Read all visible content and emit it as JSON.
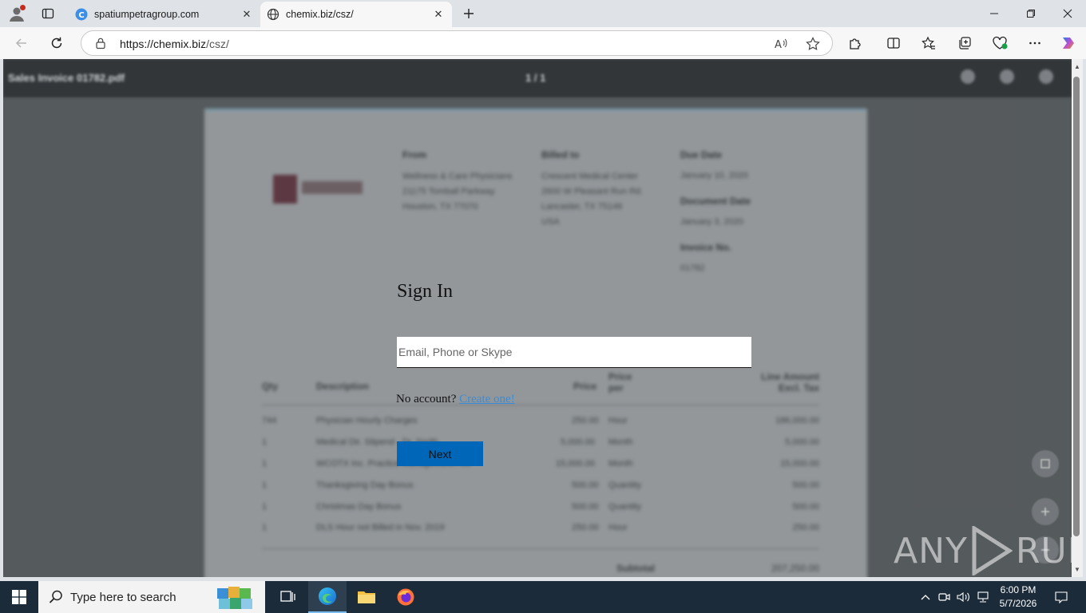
{
  "browser": {
    "tabs": [
      {
        "title": "spatiumpetragroup.com",
        "active": false
      },
      {
        "title": "chemix.biz/csz/",
        "active": true
      }
    ],
    "address": {
      "host": "https://chemix.biz",
      "path": "/csz/"
    }
  },
  "pdf_viewer": {
    "file_name": "Sales Invoice 01782.pdf",
    "page_indicator": "1 / 1"
  },
  "invoice_background": {
    "from_label": "From",
    "from_lines": [
      "Wellness & Care Physicians",
      "21175 Tomball Parkway",
      "Houston, TX 77070"
    ],
    "billed_label": "Billed to",
    "billed_lines": [
      "Crescent Medical Center",
      "2600 W Pleasant Run Rd.",
      "Lancaster, TX 75146",
      "USA"
    ],
    "due_label": "Due Date",
    "due_value": "January 10, 2020",
    "doc_label": "Document Date",
    "doc_value": "January 3, 2020",
    "inv_label": "Invoice No.",
    "inv_value": "01782",
    "columns": {
      "qty": "Qty",
      "desc": "Description",
      "price": "Price",
      "per": "Price per",
      "amount": "Line Amount Excl. Tax"
    },
    "rows": [
      {
        "qty": "744",
        "desc": "Physician Hourly Charges",
        "price": "250.00",
        "per": "Hour",
        "amount": "186,000.00"
      },
      {
        "qty": "1",
        "desc": "Medical Dir. Stipend - Dr. Smith",
        "price": "5,000.00",
        "per": "Month",
        "amount": "5,000.00"
      },
      {
        "qty": "1",
        "desc": "WCOTX Inc. Practice Management Fee",
        "price": "15,000.00",
        "per": "Month",
        "amount": "15,000.00"
      },
      {
        "qty": "1",
        "desc": "Thanksgiving Day Bonus",
        "price": "500.00",
        "per": "Quantity",
        "amount": "500.00"
      },
      {
        "qty": "1",
        "desc": "Christmas Day Bonus",
        "price": "500.00",
        "per": "Quantity",
        "amount": "500.00"
      },
      {
        "qty": "1",
        "desc": "DLS Hour not Billed in Nov. 2019",
        "price": "250.00",
        "per": "Hour",
        "amount": "250.00"
      }
    ],
    "subtotal_label": "Subtotal",
    "subtotal_value": "207,250.00"
  },
  "signin": {
    "title": "Sign In",
    "email_placeholder": "Email, Phone or Skype",
    "email_value": "",
    "no_account_text": "No account?",
    "create_link": "Create one!",
    "next_label": "Next"
  },
  "watermark": {
    "left": "ANY",
    "right": "RUN"
  },
  "taskbar": {
    "search_placeholder": "Type here to search",
    "time": "6:00 PM",
    "date": "5/7/2026"
  },
  "colors": {
    "accent": "#0067b8",
    "link": "#3a8cd8",
    "taskbar": "#1c2b3a"
  }
}
